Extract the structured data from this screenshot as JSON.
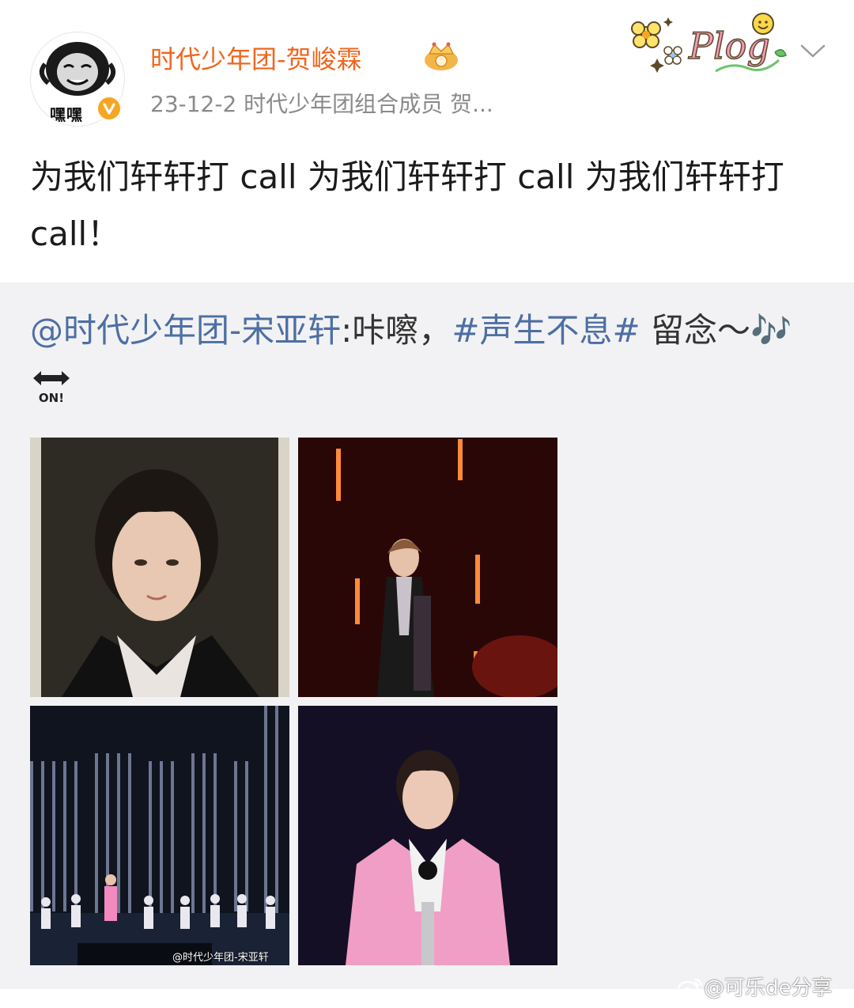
{
  "post": {
    "author_name": "时代少年团-贺峻霖",
    "avatar_caption": "嘿嘿",
    "verified_icon": "verified-badge-icon",
    "rank_icon": "crown-icon",
    "meta": "23-12-2  时代少年团组合成员 贺...",
    "sticker_text": "Plog",
    "menu_icon": "chevron-down-icon",
    "text": "为我们轩轩打 call 为我们轩轩打 call 为我们轩轩打 call！"
  },
  "repost": {
    "mention": "@时代少年团-宋亚轩",
    "text_mid": ":咔嚓，",
    "hashtag": "#声生不息#",
    "text_end": " 留念～🎶",
    "on_label": "ON!",
    "photo_watermark": "@时代少年团-宋亚轩"
  },
  "watermark": {
    "text": "@可乐de分享",
    "icon": "weibo-logo-icon"
  },
  "colors": {
    "author_name": "#f0661e",
    "link": "#4d6fa3",
    "repost_background": "#f2f2f4",
    "verified_badge": "#f6a623"
  }
}
